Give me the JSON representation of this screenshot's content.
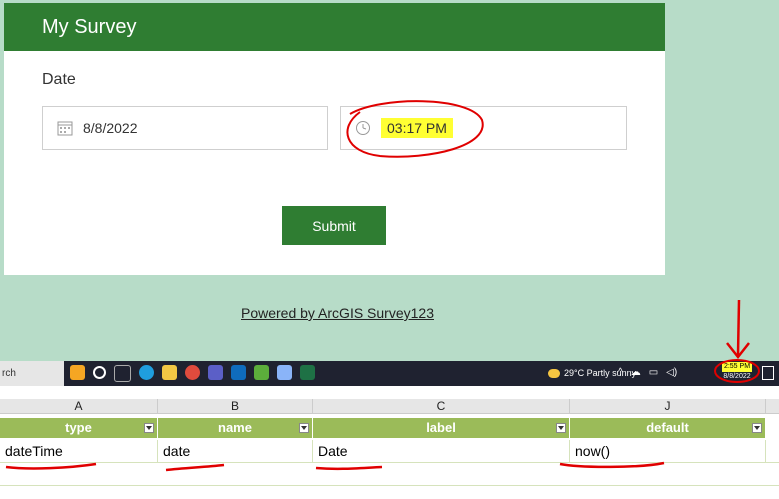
{
  "survey": {
    "title": "My Survey",
    "question_label": "Date",
    "date_value": "8/8/2022",
    "time_value": "03:17 PM",
    "submit_label": "Submit",
    "powered_by": "Powered by ArcGIS Survey123"
  },
  "taskbar": {
    "search_text": "rch",
    "weather": "29°C  Partly sunny",
    "clock_time": "2:55 PM",
    "clock_date": "8/8/2022"
  },
  "spreadsheet": {
    "column_letters": [
      "A",
      "B",
      "C",
      "J"
    ],
    "headers": [
      "type",
      "name",
      "label",
      "default"
    ],
    "row": [
      "dateTime",
      "date",
      "Date",
      "now()"
    ]
  },
  "colors": {
    "survey_green": "#2f7d32",
    "background": "#b7dcc8",
    "header_green": "#9bbb59",
    "highlight": "#ffff33",
    "annotation_red": "#e00000"
  }
}
